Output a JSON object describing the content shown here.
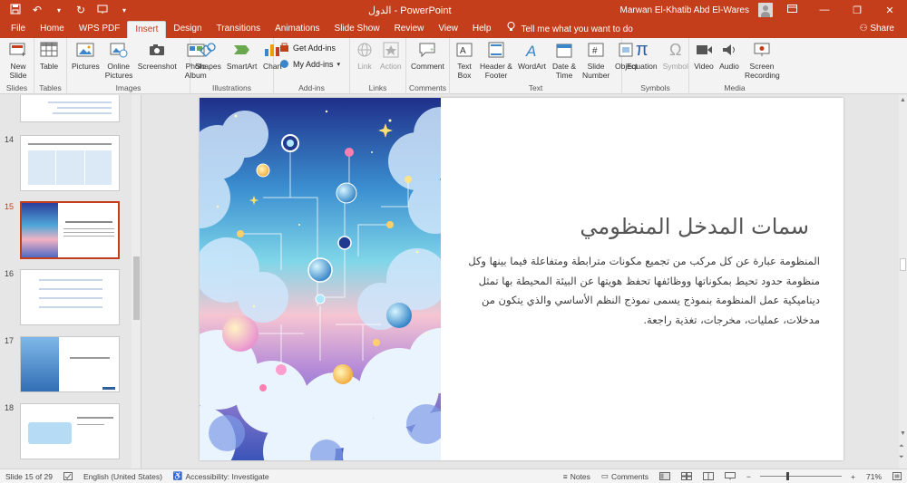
{
  "window": {
    "title": "الدول - PowerPoint",
    "user": "Marwan El-Khatib Abd El-Wares"
  },
  "menu": {
    "tabs": [
      {
        "label": "File"
      },
      {
        "label": "Home"
      },
      {
        "label": "WPS PDF"
      },
      {
        "label": "Insert",
        "active": true
      },
      {
        "label": "Design"
      },
      {
        "label": "Transitions"
      },
      {
        "label": "Animations"
      },
      {
        "label": "Slide Show"
      },
      {
        "label": "Review"
      },
      {
        "label": "View"
      },
      {
        "label": "Help"
      }
    ],
    "tell_me": "Tell me what you want to do",
    "share": "Share"
  },
  "ribbon": {
    "slides": {
      "label": "Slides",
      "new_slide": "New Slide"
    },
    "tables": {
      "label": "Tables",
      "table": "Table"
    },
    "images": {
      "label": "Images",
      "pictures": "Pictures",
      "online_pictures": "Online Pictures",
      "screenshot": "Screenshot",
      "photo_album": "Photo Album"
    },
    "illustrations": {
      "label": "Illustrations",
      "shapes": "Shapes",
      "smartart": "SmartArt",
      "chart": "Chart"
    },
    "addins": {
      "label": "Add-ins",
      "get": "Get Add-ins",
      "my": "My Add-ins"
    },
    "links": {
      "label": "Links",
      "link": "Link",
      "action": "Action"
    },
    "comments": {
      "label": "Comments",
      "comment": "Comment"
    },
    "text": {
      "label": "Text",
      "text_box": "Text Box",
      "header_footer": "Header & Footer",
      "wordart": "WordArt",
      "date_time": "Date & Time",
      "slide_number": "Slide Number",
      "object": "Object"
    },
    "symbols": {
      "label": "Symbols",
      "equation": "Equation",
      "symbol": "Symbol"
    },
    "media": {
      "label": "Media",
      "video": "Video",
      "audio": "Audio",
      "screen_recording": "Screen Recording"
    }
  },
  "thumbnails": [
    {
      "number": "",
      "active": false
    },
    {
      "number": "14",
      "active": false
    },
    {
      "number": "15",
      "active": true
    },
    {
      "number": "16",
      "active": false
    },
    {
      "number": "17",
      "active": false
    },
    {
      "number": "18",
      "active": false
    }
  ],
  "slide": {
    "title": "سمات المدخل المنظومي",
    "body": "المنظومة عبارة عن كل مركب من تجميع مكونات مترابطة ومتفاعلة فيما بينها وكل منظومة حدود تحيط بمكوناتها ووظائفها تحفظ هويتها عن البيئة المحيطة بها تمثل ديناميكية عمل المنظومة بنموذج يسمى نموذج النظم الأساسي والذي يتكون من مدخلات، عمليات، مخرجات، تغذية راجعة."
  },
  "status": {
    "slide_info": "Slide 15 of 29",
    "language": "English (United States)",
    "accessibility": "Accessibility: Investigate",
    "notes": "Notes",
    "comments": "Comments",
    "zoom": "71%",
    "zoom_level": 0.71
  },
  "colors": {
    "accent": "#c43e1c"
  }
}
